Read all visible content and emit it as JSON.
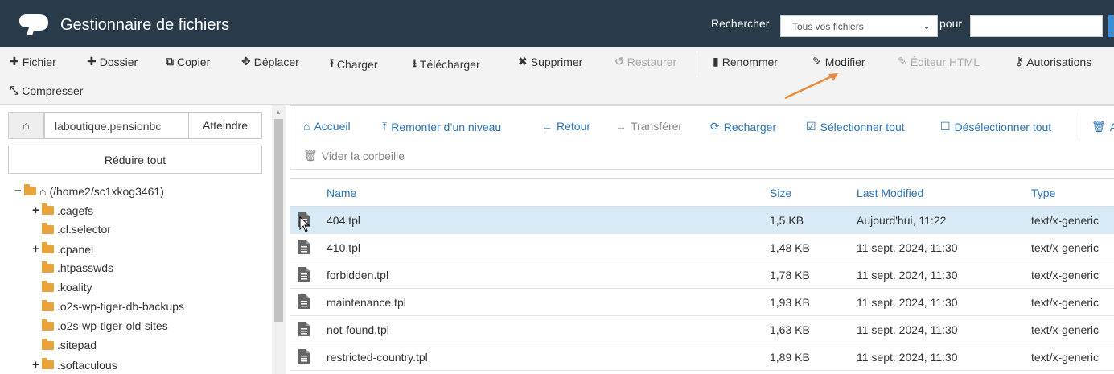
{
  "header": {
    "title": "Gestionnaire de fichiers",
    "search_label": "Rechercher",
    "search_scope": "Tous vos fichiers",
    "for_label": "pour",
    "search_value": ""
  },
  "toolbar": {
    "file": "Fichier",
    "folder": "Dossier",
    "copy": "Copier",
    "move": "Déplacer",
    "upload": "Charger",
    "download": "Télécharger",
    "delete": "Supprimer",
    "restore": "Restaurer",
    "rename": "Renommer",
    "edit": "Modifier",
    "html_editor": "Éditeur HTML",
    "permissions": "Autorisations",
    "compress": "Compresser"
  },
  "left": {
    "path_value": "laboutique.pensionbc",
    "goto": "Atteindre",
    "collapse_all": "Réduire tout",
    "tree": [
      {
        "label": "(/home2/sc1xkog3461)"
      },
      {
        "label": ".cagefs"
      },
      {
        "label": ".cl.selector"
      },
      {
        "label": ".cpanel"
      },
      {
        "label": ".htpasswds"
      },
      {
        "label": ".koality"
      },
      {
        "label": ".o2s-wp-tiger-db-backups"
      },
      {
        "label": ".o2s-wp-tiger-old-sites"
      },
      {
        "label": ".sitepad"
      },
      {
        "label": ".softaculous"
      }
    ]
  },
  "nav": {
    "home": "Accueil",
    "up": "Remonter d’un niveau",
    "back": "Retour",
    "forward": "Transférer",
    "reload": "Recharger",
    "select_all": "Sélectionner tout",
    "deselect_all": "Désélectionner tout",
    "trash_partial": "Af",
    "empty_trash": "Vider la corbeille"
  },
  "table": {
    "columns": {
      "name": "Name",
      "size": "Size",
      "modified": "Last Modified",
      "type": "Type"
    },
    "rows": [
      {
        "name": "404.tpl",
        "size": "1,5 KB",
        "modified": "Aujourd'hui, 11:22",
        "type": "text/x-generic"
      },
      {
        "name": "410.tpl",
        "size": "1,48 KB",
        "modified": "11 sept. 2024, 11:30",
        "type": "text/x-generic"
      },
      {
        "name": "forbidden.tpl",
        "size": "1,78 KB",
        "modified": "11 sept. 2024, 11:30",
        "type": "text/x-generic"
      },
      {
        "name": "maintenance.tpl",
        "size": "1,93 KB",
        "modified": "11 sept. 2024, 11:30",
        "type": "text/x-generic"
      },
      {
        "name": "not-found.tpl",
        "size": "1,63 KB",
        "modified": "11 sept. 2024, 11:30",
        "type": "text/x-generic"
      },
      {
        "name": "restricted-country.tpl",
        "size": "1,89 KB",
        "modified": "11 sept. 2024, 11:30",
        "type": "text/x-generic"
      }
    ]
  },
  "colors": {
    "header_bg": "#293a4a",
    "link_blue": "#2a74b8",
    "folder": "#e8a33b",
    "selected_row": "#d9eaf7",
    "annotation_arrow": "#e98a3c"
  }
}
